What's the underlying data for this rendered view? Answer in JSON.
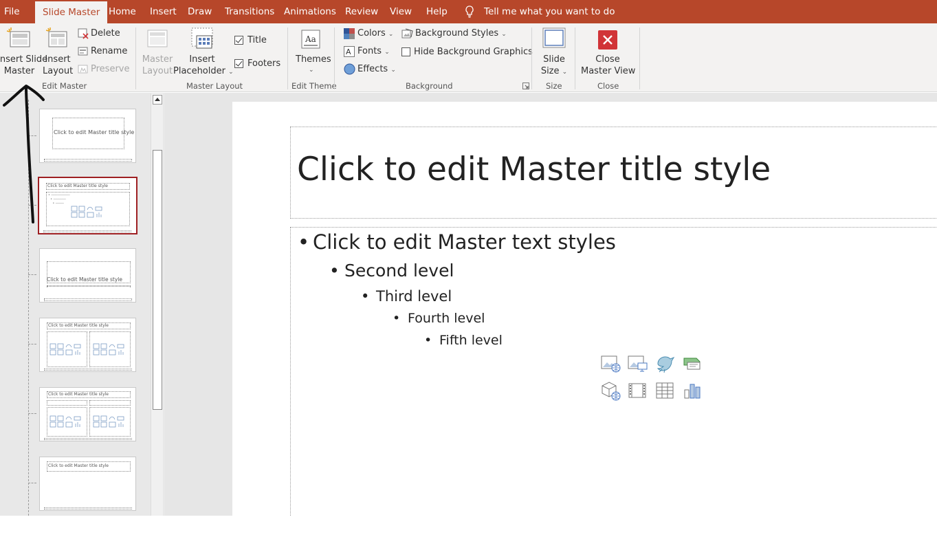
{
  "menu": {
    "tabs": [
      "File",
      "Slide Master",
      "Home",
      "Insert",
      "Draw",
      "Transitions",
      "Animations",
      "Review",
      "View",
      "Help"
    ],
    "tell_me": "Tell me what you want to do"
  },
  "ribbon": {
    "edit_master": {
      "insert_slide_master": [
        "Insert Slide",
        "Master"
      ],
      "insert_layout": [
        "Insert",
        "Layout"
      ],
      "delete": "Delete",
      "rename": "Rename",
      "preserve": "Preserve",
      "label": "Edit Master"
    },
    "master_layout": {
      "master_layout": [
        "Master",
        "Layout"
      ],
      "insert_placeholder": [
        "Insert",
        "Placeholder"
      ],
      "title": "Title",
      "footers": "Footers",
      "label": "Master Layout"
    },
    "edit_theme": {
      "themes": "Themes",
      "label": "Edit Theme"
    },
    "background": {
      "colors": "Colors",
      "fonts": "Fonts",
      "effects": "Effects",
      "background_styles": "Background Styles",
      "hide_background_graphics": "Hide Background Graphics",
      "label": "Background"
    },
    "size": {
      "slide_size": [
        "Slide",
        "Size"
      ],
      "label": "Size"
    },
    "close": {
      "close_master_view": [
        "Close",
        "Master View"
      ],
      "label": "Close"
    }
  },
  "thumbnails": [
    {
      "title": "Click to edit Master title style"
    },
    {
      "title": "Click to edit Master title style"
    },
    {
      "title": "Click to edit Master title style"
    },
    {
      "title": "Click to edit Master title style"
    },
    {
      "title": "Click to edit Master title style"
    },
    {
      "title": "Click to edit Master title style"
    }
  ],
  "slide": {
    "title": "Click to edit Master title style",
    "levels": [
      "Click to edit Master text styles",
      "Second level",
      "Third level",
      "Fourth level",
      "Fifth level"
    ]
  },
  "colors": {
    "accent": "#b7472a",
    "close_red": "#d13438",
    "selection": "#9e1f22"
  }
}
